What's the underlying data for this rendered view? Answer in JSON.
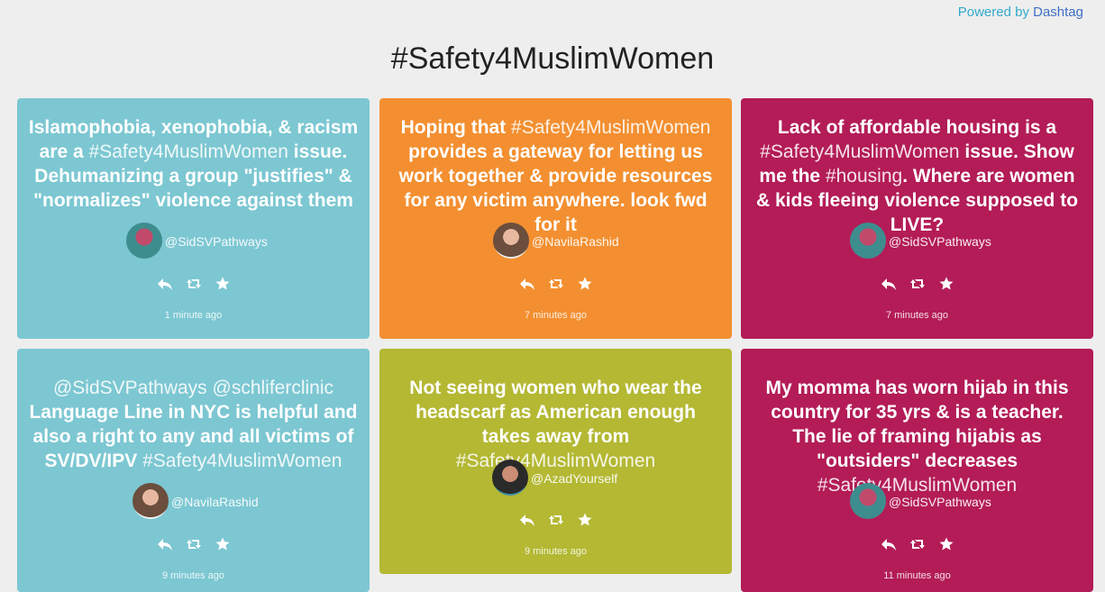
{
  "header": {
    "powered_prefix": "Powered by",
    "powered_brand": "Dashtag",
    "title": "#Safety4MuslimWomen"
  },
  "colors": {
    "teal": "#7cc7d2",
    "orange": "#f38f30",
    "magenta": "#b31c57",
    "olive": "#b4b833"
  },
  "cards": [
    {
      "text_a": "Islamophobia, xenophobia, & racism are a ",
      "tag1": "#Safety4MuslimWomen",
      "text_b": " issue. Dehumanizing a group \"justifies\" & \"normalizes\" violence against them",
      "handle": "@SidSVPathways",
      "time": "1 minute ago"
    },
    {
      "text_a": "Hoping that ",
      "tag1": "#Safety4MuslimWomen",
      "text_b": " provides a gateway for letting us work together & provide resources for any victim anywhere. look fwd for it",
      "handle": "@NavilaRashid",
      "time": "7 minutes ago"
    },
    {
      "text_a": "Lack of affordable housing is a ",
      "tag1": "#Safety4MuslimWomen",
      "text_b": " issue. Show me the ",
      "tag2": "#housing",
      "text_c": ". Where are women & kids fleeing violence supposed to LIVE?",
      "handle": "@SidSVPathways",
      "time": "7 minutes ago"
    },
    {
      "tag0": "@SidSVPathways @schliferclinic",
      "text_a": " Language Line in NYC is helpful and also a right to any and all victims of SV/DV/IPV ",
      "tag1": "#Safety4MuslimWomen",
      "handle": "@NavilaRashid",
      "time": "9 minutes ago"
    },
    {
      "text_a": "Not seeing women who wear the headscarf as American enough takes away from ",
      "tag1": "#Safety4MuslimWomen",
      "handle": "@AzadYourself",
      "time": "9 minutes ago"
    },
    {
      "text_a": "My momma has worn hijab in this country for 35 yrs & is a teacher. The lie of framing hijabis as \"outsiders\" decreases ",
      "tag1": "#Safety4MuslimWomen",
      "handle": "@SidSVPathways",
      "time": "11 minutes ago"
    }
  ],
  "icons": {
    "reply": "reply-icon",
    "retweet": "retweet-icon",
    "favorite": "star-icon"
  }
}
